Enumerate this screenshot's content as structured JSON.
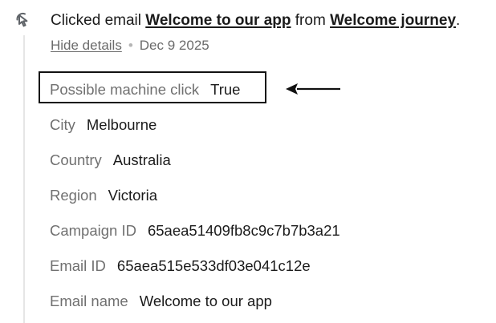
{
  "event": {
    "icon": "cursor-click-icon",
    "prefix": "Clicked email ",
    "email_link": "Welcome to our app",
    "middle": " from ",
    "journey_link": "Welcome journey",
    "suffix": ".",
    "hide_details": "Hide details",
    "separator": "•",
    "date": "Dec 9 2025"
  },
  "details": [
    {
      "label": "Possible machine click",
      "value": "True"
    },
    {
      "label": "City",
      "value": "Melbourne"
    },
    {
      "label": "Country",
      "value": "Australia"
    },
    {
      "label": "Region",
      "value": "Victoria"
    },
    {
      "label": "Campaign ID",
      "value": "65aea51409fb8c9c7b7b3a21"
    },
    {
      "label": "Email ID",
      "value": "65aea515e533df03e041c12e"
    },
    {
      "label": "Email name",
      "value": "Welcome to our app"
    }
  ],
  "annotation": {
    "arrow_icon": "left-arrow-icon",
    "box_color": "#111111"
  }
}
